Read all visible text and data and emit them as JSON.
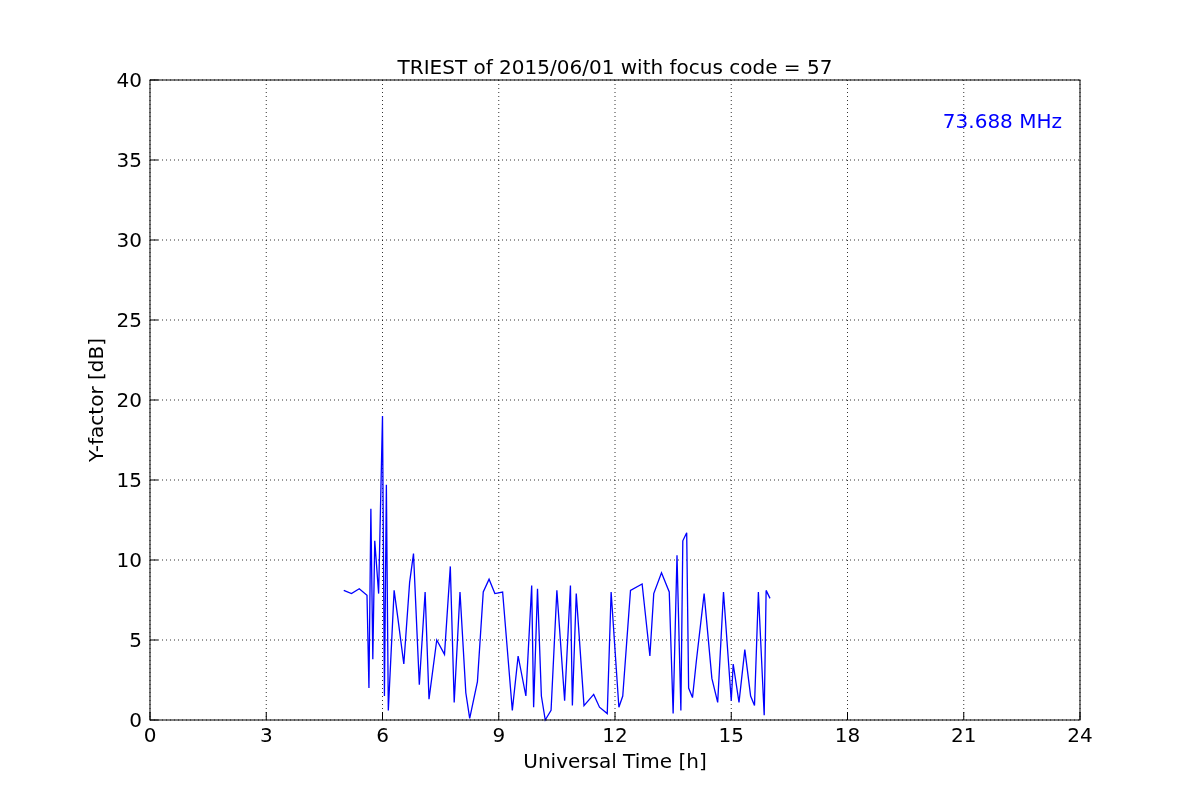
{
  "chart_data": {
    "type": "line",
    "title": "TRIEST of 2015/06/01 with focus code = 57",
    "xlabel": "Universal Time [h]",
    "ylabel": "Y-factor [dB]",
    "x": [
      5.0,
      5.2,
      5.4,
      5.6,
      5.65,
      5.7,
      5.75,
      5.8,
      5.9,
      6.0,
      6.05,
      6.1,
      6.15,
      6.3,
      6.4,
      6.55,
      6.7,
      6.8,
      6.95,
      7.1,
      7.2,
      7.4,
      7.6,
      7.75,
      7.85,
      8.0,
      8.15,
      8.25,
      8.45,
      8.6,
      8.75,
      8.9,
      9.1,
      9.35,
      9.5,
      9.7,
      9.85,
      9.9,
      10.0,
      10.1,
      10.2,
      10.35,
      10.5,
      10.7,
      10.85,
      10.9,
      11.0,
      11.2,
      11.45,
      11.6,
      11.8,
      11.9,
      12.1,
      12.2,
      12.4,
      12.7,
      12.9,
      13.0,
      13.2,
      13.4,
      13.5,
      13.6,
      13.7,
      13.75,
      13.85,
      13.9,
      14.0,
      14.1,
      14.3,
      14.5,
      14.65,
      14.8,
      15.0,
      15.05,
      15.2,
      15.35,
      15.5,
      15.6,
      15.7,
      15.85,
      15.9,
      16.0
    ],
    "series": [
      {
        "name": "73.688 MHz",
        "color": "#0000ff",
        "values": [
          8.1,
          7.9,
          8.2,
          7.8,
          2.0,
          13.2,
          3.8,
          11.2,
          7.9,
          19.0,
          1.5,
          14.7,
          0.6,
          8.1,
          6.3,
          3.5,
          8.6,
          10.4,
          2.2,
          8.0,
          1.3,
          5.0,
          4.1,
          9.6,
          1.1,
          8.0,
          1.7,
          0.1,
          2.4,
          8.0,
          8.8,
          7.9,
          8.0,
          0.6,
          4.0,
          1.5,
          8.4,
          0.8,
          8.2,
          1.5,
          0.0,
          0.6,
          8.1,
          1.2,
          8.4,
          0.9,
          7.9,
          0.9,
          1.6,
          0.8,
          0.4,
          8.0,
          0.8,
          1.5,
          8.1,
          8.5,
          4.0,
          7.9,
          9.2,
          8.0,
          0.4,
          10.3,
          0.6,
          11.2,
          11.7,
          2.0,
          1.4,
          3.7,
          7.9,
          2.6,
          1.1,
          8.0,
          1.2,
          3.5,
          1.1,
          4.4,
          1.5,
          0.9,
          8.0,
          0.3,
          8.1,
          7.6
        ]
      }
    ],
    "xlim": [
      0,
      24
    ],
    "ylim": [
      0,
      40
    ],
    "xticks": [
      0,
      3,
      6,
      9,
      12,
      15,
      18,
      21,
      24
    ],
    "yticks": [
      0,
      5,
      10,
      15,
      20,
      25,
      30,
      35,
      40
    ],
    "grid": true
  }
}
